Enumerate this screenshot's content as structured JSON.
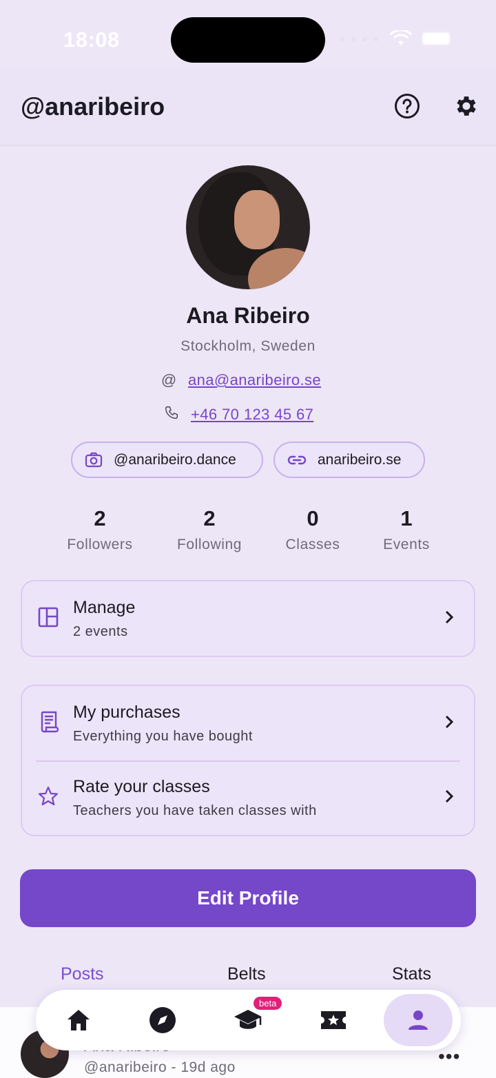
{
  "status_bar": {
    "time": "18:08"
  },
  "header": {
    "handle": "@anaribeiro"
  },
  "profile": {
    "name": "Ana Ribeiro",
    "location": "Stockholm, Sweden",
    "email": "ana@anaribeiro.se",
    "phone": "+46 70 123 45 67",
    "instagram": "@anaribeiro.dance",
    "website": "anaribeiro.se"
  },
  "stats": [
    {
      "value": "2",
      "label": "Followers"
    },
    {
      "value": "2",
      "label": "Following"
    },
    {
      "value": "0",
      "label": "Classes"
    },
    {
      "value": "1",
      "label": "Events"
    }
  ],
  "manage_card": {
    "title": "Manage",
    "subtitle": "2 events"
  },
  "list_card": {
    "items": [
      {
        "title": "My purchases",
        "subtitle": "Everything you have bought"
      },
      {
        "title": "Rate your classes",
        "subtitle": "Teachers you have taken classes with"
      }
    ]
  },
  "edit_button": {
    "label": "Edit Profile"
  },
  "tabs": [
    {
      "label": "Posts",
      "active": true
    },
    {
      "label": "Belts",
      "active": false
    },
    {
      "label": "Stats",
      "active": false
    }
  ],
  "post_preview": {
    "author": "Ana Ribeiro",
    "meta": "@anaribeiro - 19d ago"
  },
  "bottom_nav": {
    "items": [
      {
        "icon": "home-icon"
      },
      {
        "icon": "compass-icon"
      },
      {
        "icon": "graduation-cap-icon",
        "badge": "beta"
      },
      {
        "icon": "ticket-star-icon"
      },
      {
        "icon": "person-icon",
        "active": true
      }
    ]
  },
  "colors": {
    "accent": "#7547c9",
    "background": "#ede6f7",
    "badge": "#e0217a"
  }
}
